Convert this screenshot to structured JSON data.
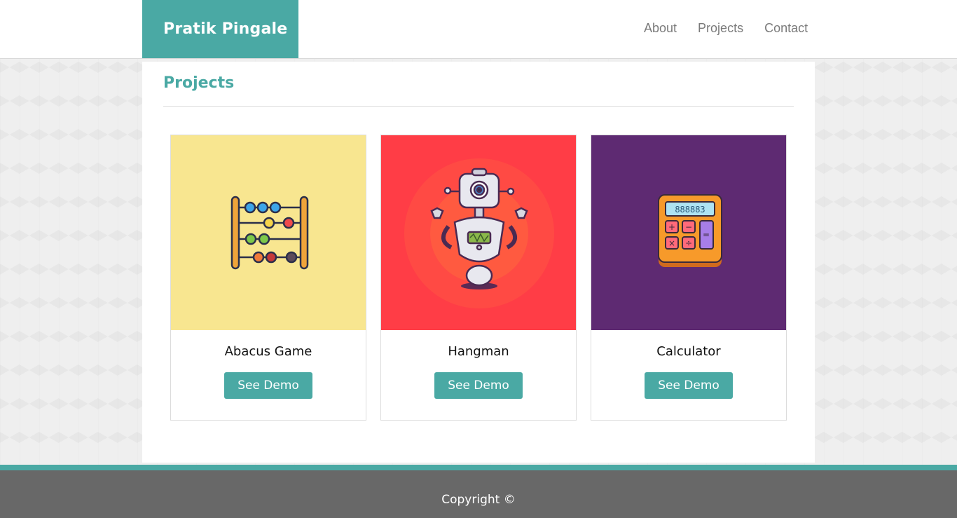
{
  "header": {
    "brand": "Pratik Pingale",
    "nav": [
      "About",
      "Projects",
      "Contact"
    ]
  },
  "projects_section": {
    "title": "Projects",
    "cards": [
      {
        "name": "Abacus Game",
        "button": "See Demo",
        "bg": "#f8e690",
        "icon": "abacus-icon"
      },
      {
        "name": "Hangman",
        "button": "See Demo",
        "bg": "#ff3d46",
        "icon": "robot-icon"
      },
      {
        "name": "Calculator",
        "button": "See Demo",
        "bg": "#5e2a72",
        "icon": "calculator-icon",
        "display": "888883"
      }
    ]
  },
  "footer": {
    "copyright": "Copyright ©"
  },
  "colors": {
    "accent": "#4aa9a4",
    "footer": "#686868"
  }
}
